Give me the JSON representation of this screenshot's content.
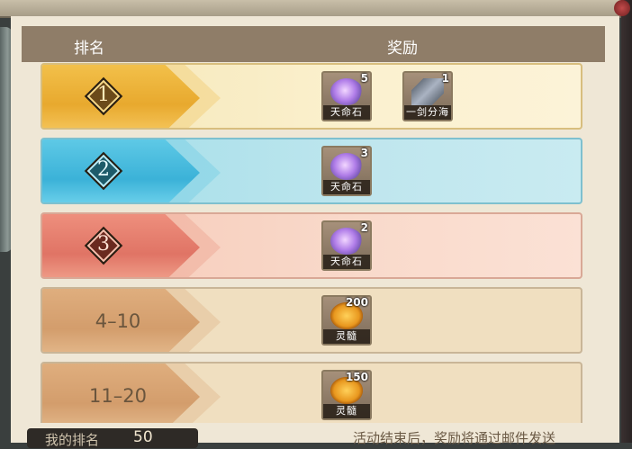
{
  "header": {
    "rank_label": "排名",
    "reward_label": "奖励"
  },
  "rows": [
    {
      "rank": "1",
      "rewards": [
        {
          "name": "天命石",
          "count": "5",
          "icon": "destiny-stone-icon"
        },
        {
          "name": "一剑分海",
          "count": "1",
          "icon": "sword-scroll-icon"
        }
      ]
    },
    {
      "rank": "2",
      "rewards": [
        {
          "name": "天命石",
          "count": "3",
          "icon": "destiny-stone-icon"
        }
      ]
    },
    {
      "rank": "3",
      "rewards": [
        {
          "name": "天命石",
          "count": "2",
          "icon": "destiny-stone-icon"
        }
      ]
    },
    {
      "rank": "4–10",
      "rewards": [
        {
          "name": "灵髓",
          "count": "200",
          "icon": "spirit-marrow-icon"
        }
      ]
    },
    {
      "rank": "11–20",
      "rewards": [
        {
          "name": "灵髓",
          "count": "150",
          "icon": "spirit-marrow-icon"
        }
      ]
    }
  ],
  "footer": {
    "my_rank_label": "我的排名",
    "my_rank_value": "50",
    "notice": "活动结束后，奖励将通过邮件发送"
  }
}
